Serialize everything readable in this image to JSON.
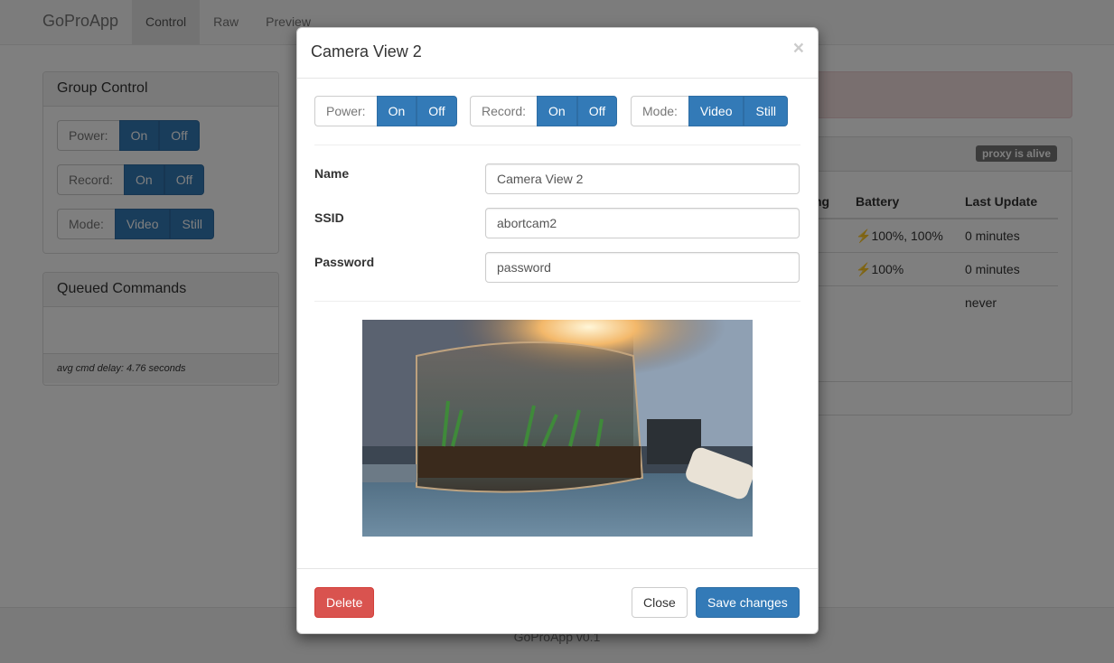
{
  "navbar": {
    "brand": "GoProApp",
    "items": [
      "Control",
      "Raw",
      "Preview"
    ]
  },
  "group_control": {
    "title": "Group Control",
    "power": {
      "label": "Power:",
      "on": "On",
      "off": "Off"
    },
    "record": {
      "label": "Record:",
      "on": "On",
      "off": "Off"
    },
    "mode": {
      "label": "Mode:",
      "video": "Video",
      "still": "Still"
    }
  },
  "queued_commands": {
    "title": "Queued Commands",
    "footer": "avg cmd delay: 4.76 seconds"
  },
  "cameras_panel": {
    "badge": "proxy is alive",
    "columns": [
      "ng",
      "Battery",
      "Last Update"
    ],
    "rows": [
      {
        "battery": "100%, 100%",
        "last_update": "0 minutes"
      },
      {
        "battery": "100%",
        "last_update": "0 minutes"
      },
      {
        "battery": "",
        "last_update": "never"
      }
    ]
  },
  "footer": {
    "text": "GoProApp v0.1"
  },
  "modal": {
    "title": "Camera View 2",
    "close_glyph": "×",
    "power": {
      "label": "Power:",
      "on": "On",
      "off": "Off"
    },
    "record": {
      "label": "Record:",
      "on": "On",
      "off": "Off"
    },
    "mode": {
      "label": "Mode:",
      "video": "Video",
      "still": "Still"
    },
    "fields": {
      "name": {
        "label": "Name",
        "value": "Camera View 2"
      },
      "ssid": {
        "label": "SSID",
        "value": "abortcam2"
      },
      "password": {
        "label": "Password",
        "value": "password"
      }
    },
    "buttons": {
      "delete": "Delete",
      "close": "Close",
      "save": "Save changes"
    }
  },
  "colors": {
    "primary": "#337ab7",
    "danger": "#d9534f",
    "badge": "#777777"
  },
  "icons": {
    "battery": "lightning-bolt-icon",
    "close": "close-icon"
  }
}
